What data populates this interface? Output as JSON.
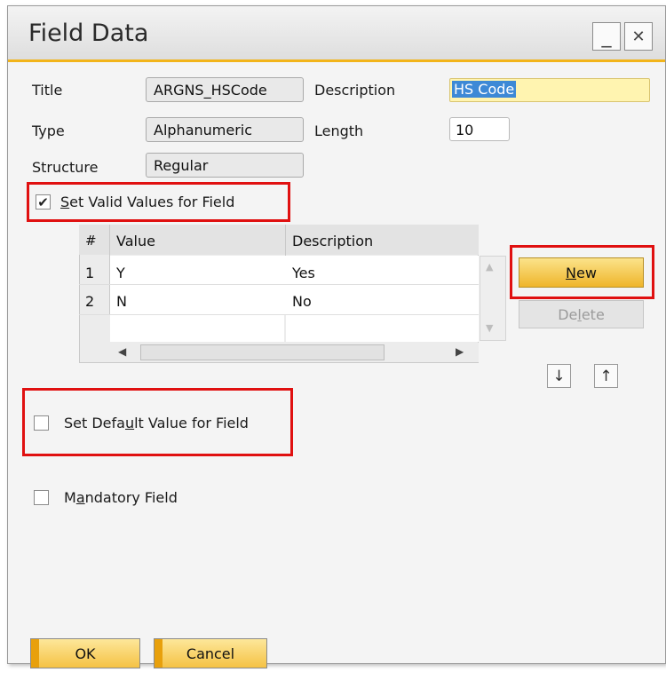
{
  "window": {
    "title": "Field Data"
  },
  "titlebar_buttons": {
    "minimize": "_",
    "close": "✕"
  },
  "fields": {
    "title": {
      "label": "Title",
      "value": "ARGNS_HSCode"
    },
    "description": {
      "label": "Description",
      "value": "HS Code"
    },
    "type": {
      "label": "Type",
      "value": "Alphanumeric"
    },
    "length": {
      "label": "Length",
      "value": "10"
    },
    "structure": {
      "label": "Structure",
      "value": "Regular"
    }
  },
  "valid_values": {
    "checked": true,
    "label_ul": "S",
    "label_rest": "et Valid Values for Field",
    "columns": [
      "#",
      "Value",
      "Description"
    ],
    "rows": [
      {
        "num": "1",
        "value": "Y",
        "description": "Yes"
      },
      {
        "num": "2",
        "value": "N",
        "description": "No"
      }
    ]
  },
  "buttons": {
    "new_ul": "N",
    "new_rest": "ew",
    "delete_pre": "De",
    "delete_ul": "l",
    "delete_post": "ete",
    "ok": "OK",
    "cancel": "Cancel"
  },
  "default_value": {
    "checked": false,
    "label_pre": "Set Defa",
    "label_ul": "u",
    "label_post": "lt Value for Field"
  },
  "mandatory": {
    "checked": false,
    "label_pre": "M",
    "label_ul": "a",
    "label_post": "ndatory Field"
  },
  "colors": {
    "accent": "#f2b41a",
    "highlight_border": "#e01010",
    "description_bg": "#fff4b0",
    "selection": "#3d89d6"
  },
  "icons": {
    "move_down": "arrow-down-icon",
    "move_up": "arrow-up-icon",
    "scroll_left": "triangle-left-icon",
    "scroll_right": "triangle-right-icon",
    "scroll_up": "triangle-up-icon",
    "scroll_down": "triangle-down-icon"
  }
}
